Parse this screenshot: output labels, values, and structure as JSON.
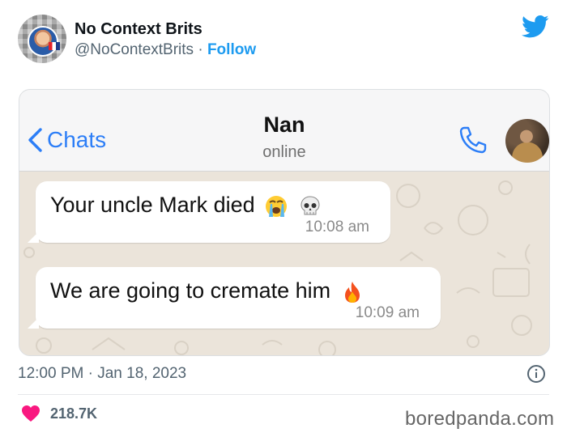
{
  "tweet": {
    "display_name": "No Context Brits",
    "handle": "@NoContextBrits",
    "separator": " · ",
    "follow_label": "Follow",
    "timestamp": "12:00 PM · Jan 18, 2023",
    "likes": "218.7K"
  },
  "chat": {
    "back_label": "Chats",
    "contact_name": "Nan",
    "contact_status": "online",
    "messages": [
      {
        "text": "Your uncle Mark died",
        "emojis": [
          "loudly-crying-face",
          "skull"
        ],
        "time": "10:08 am"
      },
      {
        "text": "We are going to cremate him",
        "emojis": [
          "fire"
        ],
        "time": "10:09 am"
      }
    ]
  },
  "watermark": "boredpanda.com",
  "colors": {
    "twitter_blue": "#1d9bf0",
    "ios_blue": "#2c7ef7",
    "like_red": "#f91880",
    "chat_wallpaper": "#ebe4da"
  },
  "icons": [
    "twitter-bird-icon",
    "chevron-left-icon",
    "phone-icon",
    "info-icon",
    "heart-icon"
  ]
}
